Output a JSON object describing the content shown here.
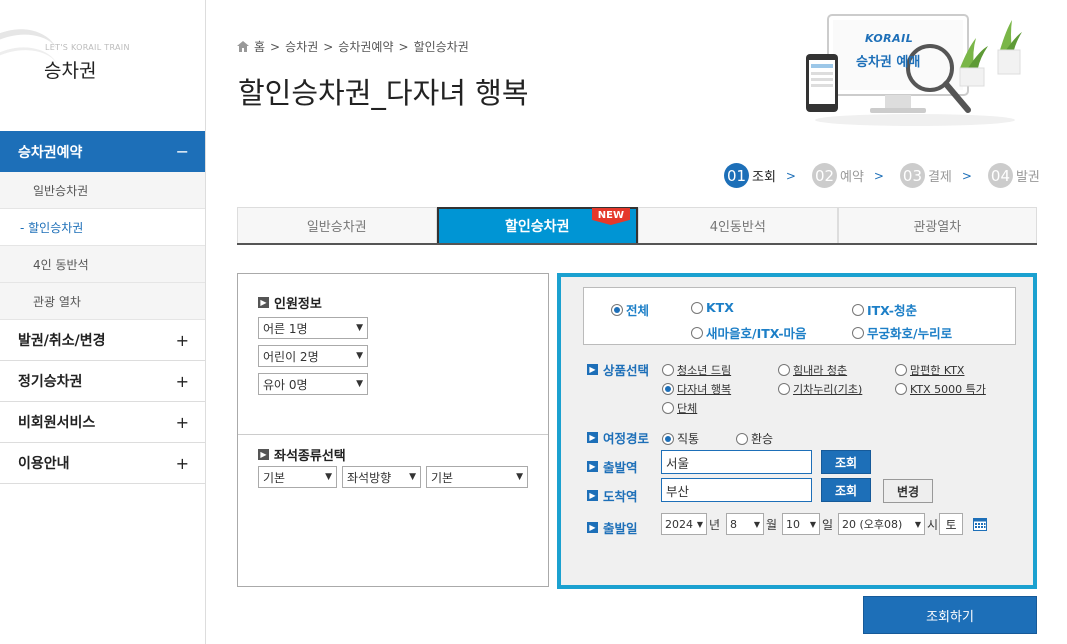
{
  "sidebar": {
    "brand_sub": "LET'S KORAIL TRAIN",
    "brand_title": "승차권",
    "items": [
      {
        "label": "승차권예약",
        "toggle": "−"
      },
      {
        "label": "발권/취소/변경",
        "toggle": "+"
      },
      {
        "label": "정기승차권",
        "toggle": "+"
      },
      {
        "label": "비회원서비스",
        "toggle": "+"
      },
      {
        "label": "이용안내",
        "toggle": "+"
      }
    ],
    "subitems": [
      {
        "label": "일반승차권"
      },
      {
        "label": "- 할인승차권"
      },
      {
        "label": "4인 동반석"
      },
      {
        "label": "관광 열차"
      }
    ]
  },
  "breadcrumb": [
    "홈",
    ">",
    "승차권",
    ">",
    "승차권예약",
    ">",
    "할인승차권"
  ],
  "page_title": "할인승차권_다자녀 행복",
  "illustration": {
    "brand": "KORAIL",
    "text": "승차권 예매"
  },
  "steps": [
    {
      "num": "01",
      "label": "조회"
    },
    {
      "num": "02",
      "label": "예약"
    },
    {
      "num": "03",
      "label": "결제"
    },
    {
      "num": "04",
      "label": "발권"
    }
  ],
  "tabs": [
    {
      "label": "일반승차권"
    },
    {
      "label": "할인승차권",
      "badge": "NEW"
    },
    {
      "label": "4인동반석"
    },
    {
      "label": "관광열차"
    }
  ],
  "passengers": {
    "title": "인원정보",
    "adult": "어른 1명",
    "child": "어린이 2명",
    "infant": "유아 0명"
  },
  "seat": {
    "title": "좌석종류선택",
    "type": "기본",
    "direction": "좌석방향",
    "position": "기본"
  },
  "train_types": {
    "all": "전체",
    "ktx": "KTX",
    "itx_cheongchun": "ITX-청춘",
    "saemaeul": "새마을호/ITX-마음",
    "mugunghwa": "무궁화호/누리로"
  },
  "product": {
    "title": "상품선택",
    "options": [
      "청소년 드림",
      "힘내라 청춘",
      "맘편한 KTX",
      "다자녀 행복",
      "기차누리(기초)",
      "KTX 5000 특가",
      "단체"
    ]
  },
  "route": {
    "title": "여정경로",
    "direct": "직통",
    "transfer": "환승"
  },
  "departure": {
    "title": "출발역",
    "value": "서울",
    "search_label": "조회"
  },
  "arrival": {
    "title": "도착역",
    "value": "부산",
    "search_label": "조회",
    "swap_label": "변경"
  },
  "date": {
    "title": "출발일",
    "year": "2024",
    "year_unit": "년",
    "month": "8",
    "month_unit": "월",
    "day": "10",
    "day_unit": "일",
    "hour": "20 (오후08)",
    "hour_unit": "시",
    "weekday": "토"
  },
  "submit_label": "조회하기",
  "colors": {
    "primary": "#1d6fb8",
    "tab_active": "#0095d4",
    "panel_border": "#1ba1d0",
    "badge": "#e5382a"
  }
}
